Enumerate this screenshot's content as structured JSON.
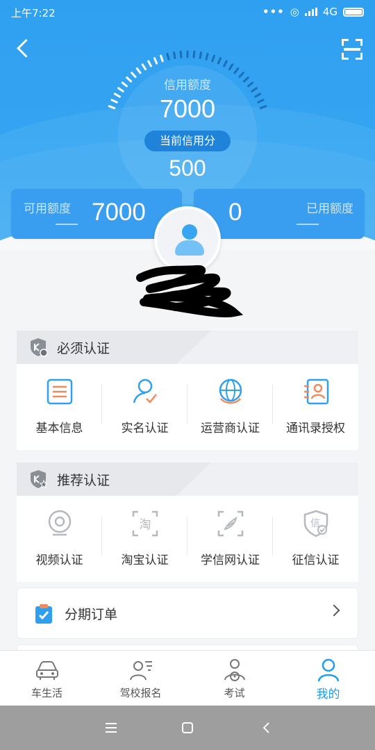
{
  "status_bar": {
    "time": "上午7:22",
    "network": "4G"
  },
  "colors": {
    "primary": "#2f9ff0",
    "accent_orange": "#f08a5d",
    "active_tab": "#1e9cf0"
  },
  "header": {
    "back_icon": "chevron-left-icon",
    "scan_icon": "scan-icon",
    "credit_label": "信用额度",
    "credit_value": "7000",
    "score_label": "当前信用分",
    "score_value": "500"
  },
  "quota": {
    "available_label": "可用额度",
    "available_value": "7000",
    "used_label": "已用额度",
    "used_value": "0"
  },
  "required_section": {
    "title": "必须认证",
    "items": [
      {
        "label": "基本信息",
        "icon": "list-icon"
      },
      {
        "label": "实名认证",
        "icon": "user-check-icon"
      },
      {
        "label": "运营商认证",
        "icon": "globe-icon"
      },
      {
        "label": "通讯录授权",
        "icon": "contacts-icon"
      }
    ]
  },
  "recommended_section": {
    "title": "推荐认证",
    "items": [
      {
        "label": "视频认证",
        "icon": "camera-icon"
      },
      {
        "label": "淘宝认证",
        "icon": "taobao-icon"
      },
      {
        "label": "学信网认证",
        "icon": "education-icon"
      },
      {
        "label": "征信认证",
        "icon": "credit-check-icon"
      }
    ]
  },
  "orders": {
    "title": "分期订单",
    "icon": "clipboard-check-icon"
  },
  "tabbar": {
    "items": [
      {
        "label": "车生活",
        "icon": "car-icon"
      },
      {
        "label": "驾校报名",
        "icon": "driving-school-icon"
      },
      {
        "label": "考试",
        "icon": "exam-icon"
      },
      {
        "label": "我的",
        "icon": "profile-icon"
      }
    ]
  }
}
